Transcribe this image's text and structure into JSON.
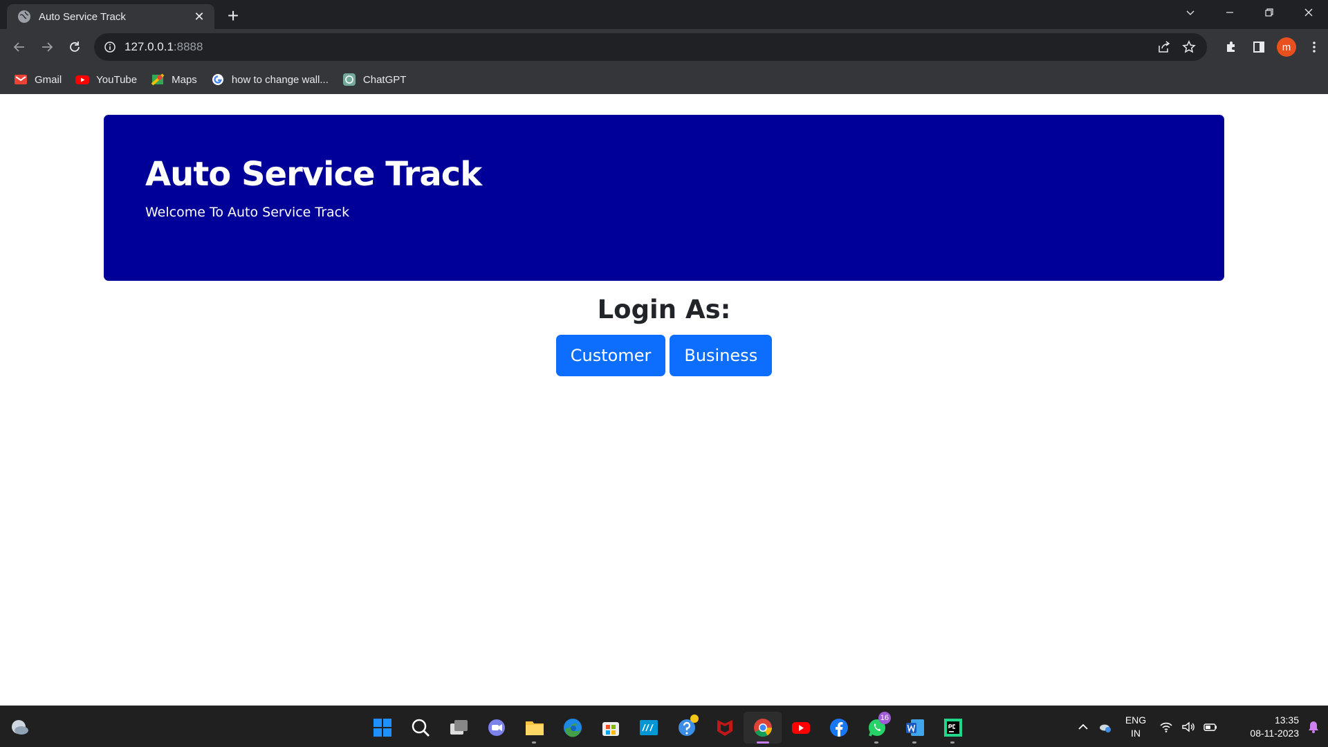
{
  "browser": {
    "tab": {
      "title": "Auto Service Track",
      "favicon": "globe-icon",
      "close_icon": "close-icon"
    },
    "new_tab_icon": "plus-icon",
    "window_controls": [
      "chevron-down-icon",
      "minimize-icon",
      "restore-icon",
      "close-icon"
    ],
    "address": {
      "host": "127.0.0.1",
      "port": ":8888"
    },
    "bookmarks": [
      {
        "label": "Gmail",
        "icon": "gmail-icon"
      },
      {
        "label": "YouTube",
        "icon": "youtube-icon"
      },
      {
        "label": "Maps",
        "icon": "maps-icon"
      },
      {
        "label": "how to change wall...",
        "icon": "google-icon"
      },
      {
        "label": "ChatGPT",
        "icon": "chatgpt-icon"
      }
    ],
    "profile_initial": "m",
    "profile_color": "#e8501e"
  },
  "page": {
    "hero": {
      "title": "Auto Service Track",
      "subtitle": "Welcome To Auto Service Track",
      "background": "#000098"
    },
    "login": {
      "heading": "Login As:",
      "buttons": [
        {
          "label": "Customer"
        },
        {
          "label": "Business"
        }
      ],
      "button_color": "#0d6efd"
    }
  },
  "taskbar": {
    "apps": [
      {
        "name": "start-icon"
      },
      {
        "name": "search-icon"
      },
      {
        "name": "task-view-icon"
      },
      {
        "name": "teams-chat-icon"
      },
      {
        "name": "file-explorer-icon"
      },
      {
        "name": "edge-icon"
      },
      {
        "name": "store-icon"
      },
      {
        "name": "myhp-icon"
      },
      {
        "name": "help-icon"
      },
      {
        "name": "mcafee-icon"
      },
      {
        "name": "chrome-icon"
      },
      {
        "name": "youtube-icon"
      },
      {
        "name": "facebook-icon"
      },
      {
        "name": "whatsapp-icon",
        "badge": "16"
      },
      {
        "name": "word-icon"
      },
      {
        "name": "pycharm-icon"
      }
    ],
    "tray": {
      "language": "ENG",
      "region": "IN",
      "time": "13:35",
      "date": "08-11-2023"
    }
  }
}
